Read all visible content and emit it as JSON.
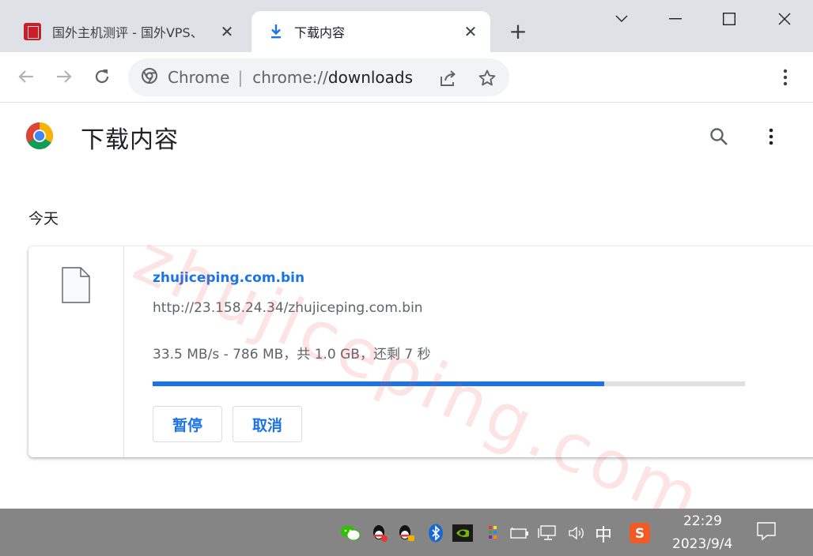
{
  "tabs": [
    {
      "title": "国外主机测评 - 国外VPS、",
      "active": false,
      "favicon": "site-logo-red"
    },
    {
      "title": "下载内容",
      "active": true,
      "favicon": "download-icon"
    }
  ],
  "tab_close_glyph": "✕",
  "new_tab_glyph": "+",
  "omnibox": {
    "site_label": "Chrome",
    "url_scheme": "chrome://",
    "url_host": "downloads"
  },
  "page": {
    "title": "下载内容"
  },
  "watermark": "zhujiceping.com",
  "downloads": {
    "date_header": "今天",
    "items": [
      {
        "filename": "zhujiceping.com.bin",
        "url": "http://23.158.24.34/zhujiceping.com.bin",
        "status": "33.5 MB/s - 786 MB，共 1.0 GB，还剩 7 秒",
        "progress": 0.763,
        "pause_label": "暂停",
        "cancel_label": "取消"
      }
    ]
  },
  "taskbar": {
    "ime": "中",
    "time": "22:29",
    "date": "2023/9/4"
  },
  "colors": {
    "accent": "#1a73e8",
    "tabstrip": "#dee1e6",
    "taskbar": "#858585",
    "watermark": "#eb5a5a"
  }
}
